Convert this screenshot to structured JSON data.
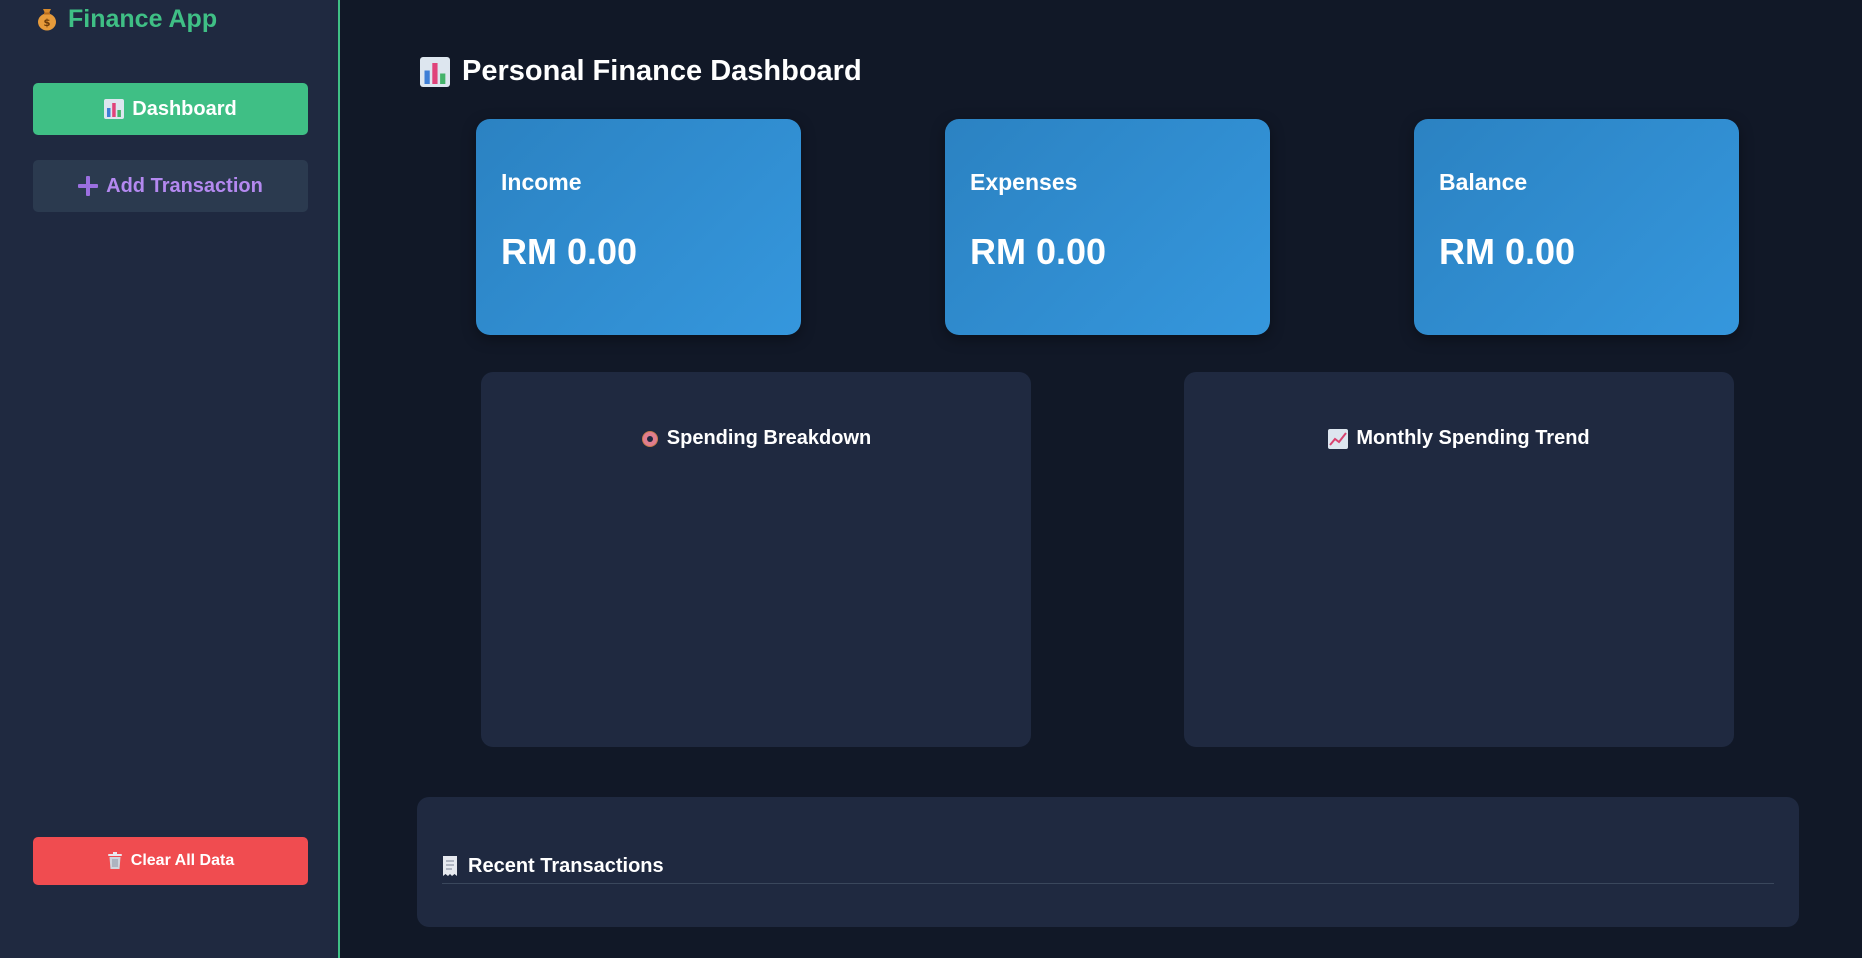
{
  "sidebar": {
    "brand": "Finance App",
    "brand_icon": "money-bag-icon",
    "nav": {
      "dashboard_label": "Dashboard",
      "add_transaction_label": "Add Transaction",
      "clear_data_label": "Clear All Data"
    }
  },
  "main": {
    "title": "Personal Finance Dashboard",
    "stats": {
      "income": {
        "label": "Income",
        "value": "RM 0.00"
      },
      "expenses": {
        "label": "Expenses",
        "value": "RM 0.00"
      },
      "balance": {
        "label": "Balance",
        "value": "RM 0.00"
      }
    },
    "charts": {
      "spending_title": "Spending Breakdown",
      "trend_title": "Monthly Spending Trend"
    },
    "transactions": {
      "title": "Recent Transactions"
    }
  },
  "colors": {
    "page_bg": "#111827",
    "panel_bg": "#1f2940",
    "accent_green": "#3fbf85",
    "accent_purple": "#b489f0",
    "danger_red": "#f04c50",
    "card_blue": "#3597dd"
  }
}
